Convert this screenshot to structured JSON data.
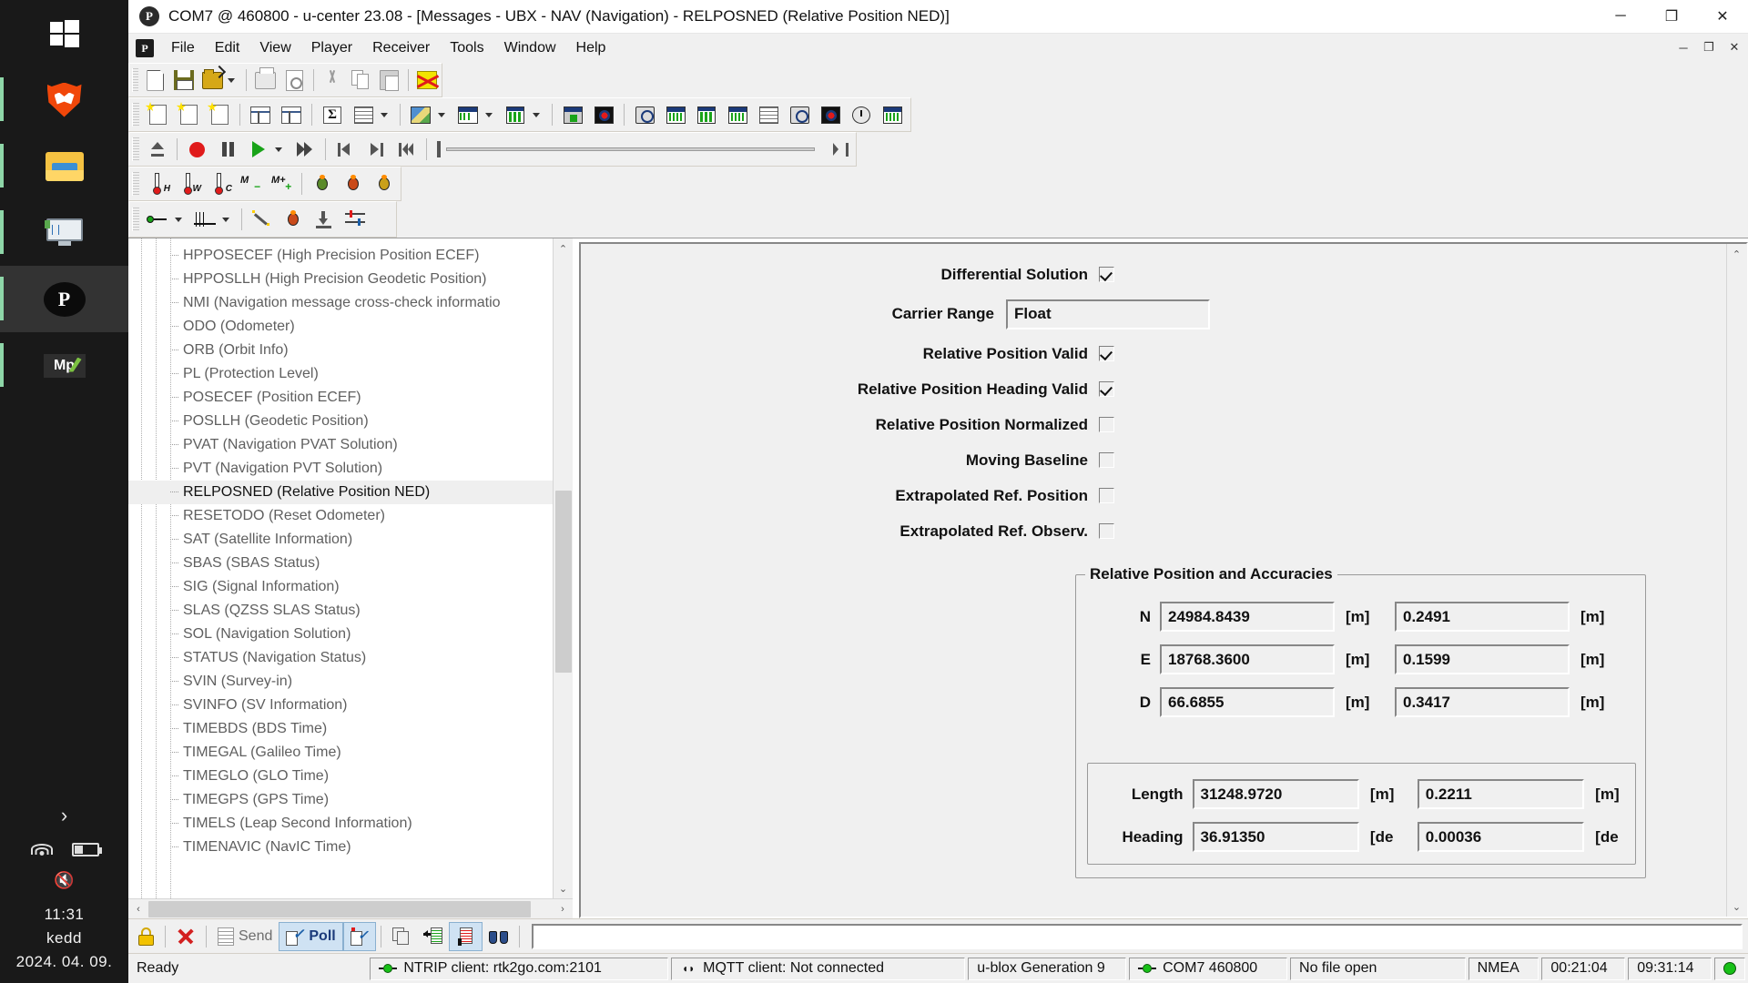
{
  "taskbar": {
    "items": [
      {
        "name": "start-button",
        "icon": "windows-logo-icon"
      },
      {
        "name": "brave-browser",
        "icon": "brave-icon"
      },
      {
        "name": "file-explorer",
        "icon": "folder-icon"
      },
      {
        "name": "monitor-app",
        "icon": "monitor-icon"
      },
      {
        "name": "u-center",
        "icon": "u-center-icon",
        "label": "P"
      },
      {
        "name": "mission-planner",
        "icon": "mission-planner-icon",
        "label": "Mp"
      }
    ],
    "tray": {
      "chevron": "›",
      "wifi": "wifi-icon",
      "battery": "battery-icon",
      "volume": "volume-muted-icon"
    },
    "clock": {
      "time": "11:31",
      "day": "kedd",
      "date": "2024. 04. 09."
    }
  },
  "window": {
    "title": "COM7 @ 460800 - u-center 23.08 - [Messages - UBX - NAV (Navigation) - RELPOSNED (Relative Position NED)]",
    "app_icon_label": "P",
    "controls": {
      "minimize": "─",
      "maximize": "❐",
      "close": "✕"
    },
    "mdi_controls": {
      "minimize": "─",
      "restore": "❐",
      "close": "✕"
    }
  },
  "menu": {
    "icon_label": "P",
    "items": [
      "File",
      "Edit",
      "View",
      "Player",
      "Receiver",
      "Tools",
      "Window",
      "Help"
    ]
  },
  "toolbars": {
    "file": [
      {
        "name": "new-document-button",
        "icon": "new-page-icon"
      },
      {
        "name": "save-button",
        "icon": "save-floppy-icon"
      },
      {
        "name": "open-button",
        "icon": "open-folder-icon"
      },
      {
        "name": "open-dropdown",
        "icon": "chevron-down-icon"
      },
      {
        "name": "print-button",
        "icon": "printer-icon"
      },
      {
        "name": "print-preview-button",
        "icon": "print-preview-icon"
      },
      {
        "name": "cut-button",
        "icon": "scissors-icon"
      },
      {
        "name": "copy-button",
        "icon": "copy-icon"
      },
      {
        "name": "paste-button",
        "icon": "paste-icon"
      },
      {
        "name": "clear-button",
        "icon": "delete-cross-icon"
      }
    ],
    "view": [
      {
        "name": "new-doc-view-button",
        "icon": "doc-star-icon"
      },
      {
        "name": "new-chart-view-button",
        "icon": "doc-star-chart-icon"
      },
      {
        "name": "new-text-view-button",
        "icon": "doc-star-text-icon"
      },
      {
        "name": "split-horizontal-button",
        "icon": "split-h-icon"
      },
      {
        "name": "split-vertical-button",
        "icon": "split-v-icon"
      },
      {
        "name": "statistics-button",
        "icon": "sigma-icon"
      },
      {
        "name": "table-view-button",
        "icon": "table-icon"
      },
      {
        "name": "table-dropdown",
        "icon": "chevron-down-icon"
      },
      {
        "name": "map-view-button",
        "icon": "map-icon"
      },
      {
        "name": "map-dropdown",
        "icon": "chevron-down-icon"
      },
      {
        "name": "chart-view-button",
        "icon": "chart-icon"
      },
      {
        "name": "chart-dropdown",
        "icon": "chevron-down-icon"
      },
      {
        "name": "histogram-button",
        "icon": "bars-icon"
      },
      {
        "name": "histogram-dropdown",
        "icon": "chevron-down-icon"
      },
      {
        "name": "deviation-map-button",
        "icon": "deviation-map-icon"
      },
      {
        "name": "sky-view-button",
        "icon": "sky-view-icon"
      },
      {
        "name": "satellite-levels-button",
        "icon": "satellite-levels-icon"
      },
      {
        "name": "data-view-button",
        "icon": "data-view-icon"
      },
      {
        "name": "signal-chart-button",
        "icon": "signal-chart-icon"
      },
      {
        "name": "scatter-button",
        "icon": "scatter-icon"
      },
      {
        "name": "list-view-button",
        "icon": "list-view-icon"
      },
      {
        "name": "compass-button",
        "icon": "compass-icon"
      },
      {
        "name": "gauge-button",
        "icon": "gauge-icon"
      },
      {
        "name": "clock-view-button",
        "icon": "clock-icon"
      },
      {
        "name": "packet-console-button",
        "icon": "packet-console-icon"
      }
    ],
    "player": [
      {
        "name": "eject-button",
        "icon": "eject-icon"
      },
      {
        "name": "record-button",
        "icon": "record-icon"
      },
      {
        "name": "pause-button",
        "icon": "pause-icon"
      },
      {
        "name": "play-button",
        "icon": "play-icon"
      },
      {
        "name": "play-dropdown",
        "icon": "chevron-down-icon"
      },
      {
        "name": "fast-forward-button",
        "icon": "fast-forward-icon"
      },
      {
        "name": "step-back-button",
        "icon": "step-back-icon"
      },
      {
        "name": "step-forward-button",
        "icon": "step-forward-icon"
      },
      {
        "name": "go-to-start-button",
        "icon": "go-to-start-icon"
      },
      {
        "name": "player-position-slider",
        "icon": "slider-icon"
      },
      {
        "name": "go-to-end-button",
        "icon": "go-to-end-icon"
      }
    ],
    "sensors": [
      {
        "name": "temperature-h-button",
        "icon": "thermometer-h-icon",
        "label": "H"
      },
      {
        "name": "temperature-w-button",
        "icon": "thermometer-w-icon",
        "label": "W"
      },
      {
        "name": "temperature-c-button",
        "icon": "thermometer-c-icon",
        "label": "C"
      },
      {
        "name": "minmax-button",
        "icon": "minmax-icon",
        "label": "M"
      },
      {
        "name": "minmax-plus-button",
        "icon": "minmax-plus-icon",
        "label": "M+"
      },
      {
        "name": "debug-1-button",
        "icon": "bug-green-icon"
      },
      {
        "name": "debug-2-button",
        "icon": "bug-orange-icon"
      },
      {
        "name": "debug-3-button",
        "icon": "bug-yellow-icon"
      }
    ],
    "connection": [
      {
        "name": "connect-button",
        "icon": "connector-icon"
      },
      {
        "name": "connect-dropdown",
        "icon": "chevron-down-icon"
      },
      {
        "name": "baudrate-button",
        "icon": "pulse-icon"
      },
      {
        "name": "baudrate-dropdown",
        "icon": "chevron-down-icon"
      },
      {
        "name": "autoconfig-button",
        "icon": "magic-wand-icon"
      },
      {
        "name": "firmware-debug-button",
        "icon": "bug-icon"
      },
      {
        "name": "firmware-update-button",
        "icon": "download-icon"
      },
      {
        "name": "configuration-button",
        "icon": "sliders-icon"
      }
    ]
  },
  "tree": {
    "items": [
      {
        "label": "HPPOSECEF (High Precision Position ECEF)",
        "selected": false
      },
      {
        "label": "HPPOSLLH (High Precision Geodetic Position)",
        "selected": false
      },
      {
        "label": "NMI (Navigation message cross-check informatio",
        "selected": false
      },
      {
        "label": "ODO (Odometer)",
        "selected": false
      },
      {
        "label": "ORB (Orbit Info)",
        "selected": false
      },
      {
        "label": "PL (Protection Level)",
        "selected": false
      },
      {
        "label": "POSECEF (Position ECEF)",
        "selected": false
      },
      {
        "label": "POSLLH (Geodetic Position)",
        "selected": false
      },
      {
        "label": "PVAT (Navigation PVAT Solution)",
        "selected": false
      },
      {
        "label": "PVT (Navigation PVT Solution)",
        "selected": false
      },
      {
        "label": "RELPOSNED (Relative Position NED)",
        "selected": true
      },
      {
        "label": "RESETODO (Reset Odometer)",
        "selected": false
      },
      {
        "label": "SAT (Satellite Information)",
        "selected": false
      },
      {
        "label": "SBAS (SBAS Status)",
        "selected": false
      },
      {
        "label": "SIG (Signal Information)",
        "selected": false
      },
      {
        "label": "SLAS (QZSS SLAS Status)",
        "selected": false
      },
      {
        "label": "SOL (Navigation Solution)",
        "selected": false
      },
      {
        "label": "STATUS (Navigation Status)",
        "selected": false
      },
      {
        "label": "SVIN (Survey-in)",
        "selected": false
      },
      {
        "label": "SVINFO (SV Information)",
        "selected": false
      },
      {
        "label": "TIMEBDS (BDS Time)",
        "selected": false
      },
      {
        "label": "TIMEGAL (Galileo Time)",
        "selected": false
      },
      {
        "label": "TIMEGLO (GLO Time)",
        "selected": false
      },
      {
        "label": "TIMEGPS (GPS Time)",
        "selected": false
      },
      {
        "label": "TIMELS (Leap Second Information)",
        "selected": false
      },
      {
        "label": "TIMENAVIC (NavIC Time)",
        "selected": false
      }
    ],
    "scroll_up_glyph": "⌃",
    "scroll_down_glyph": "⌄",
    "scroll_left_glyph": "‹",
    "scroll_right_glyph": "›"
  },
  "message": {
    "flags": [
      {
        "label": "Differential Solution",
        "checked": true
      },
      {
        "label": "Relative Position Valid",
        "checked": true
      },
      {
        "label": "Relative Position Heading Valid",
        "checked": true
      },
      {
        "label": "Relative Position Normalized",
        "checked": false
      },
      {
        "label": "Moving Baseline",
        "checked": false
      },
      {
        "label": "Extrapolated Ref. Position",
        "checked": false
      },
      {
        "label": "Extrapolated Ref. Observ.",
        "checked": false
      }
    ],
    "carrier_range": {
      "label": "Carrier Range",
      "value": "Float"
    },
    "group_title": "Relative Position and Accuracies",
    "rows": [
      {
        "label": "N",
        "value": "24984.8439",
        "unit": "[m]",
        "accuracy": "0.2491",
        "accuracy_unit": "[m]"
      },
      {
        "label": "E",
        "value": "18768.3600",
        "unit": "[m]",
        "accuracy": "0.1599",
        "accuracy_unit": "[m]"
      },
      {
        "label": "D",
        "value": "66.6855",
        "unit": "[m]",
        "accuracy": "0.3417",
        "accuracy_unit": "[m]"
      }
    ],
    "sub_rows": [
      {
        "label": "Length",
        "value": "31248.9720",
        "unit": "[m]",
        "accuracy": "0.2211",
        "accuracy_unit": "[m]"
      },
      {
        "label": "Heading",
        "value": "36.91350",
        "unit": "[de",
        "accuracy": "0.00036",
        "accuracy_unit": "[de"
      }
    ],
    "scroll_up_glyph": "⌃",
    "scroll_down_glyph": "⌄"
  },
  "bottom_toolbar": {
    "unlock_button": "unlock-icon",
    "clear_button": "clear-x-icon",
    "send_label": "Send",
    "poll_label": "Poll",
    "buttons": [
      {
        "name": "send-button",
        "icon": "send-list-icon"
      },
      {
        "name": "poll-button",
        "icon": "poll-icon"
      },
      {
        "name": "poll-auto-button",
        "icon": "poll-magic-icon"
      },
      {
        "name": "duplicate-button",
        "icon": "copies-icon"
      },
      {
        "name": "import-button",
        "icon": "import-arrow-icon"
      },
      {
        "name": "export-button",
        "icon": "export-arrow-icon"
      },
      {
        "name": "find-button",
        "icon": "binoculars-icon"
      }
    ]
  },
  "statusbar": {
    "ready": "Ready",
    "ntrip": "NTRIP client: rtk2go.com:2101",
    "mqtt": "MQTT client: Not connected",
    "generation": "u-blox Generation 9",
    "port": "COM7 460800",
    "file": "No file open",
    "protocol": "NMEA",
    "elapsed": "00:21:04",
    "clock": "09:31:14"
  }
}
